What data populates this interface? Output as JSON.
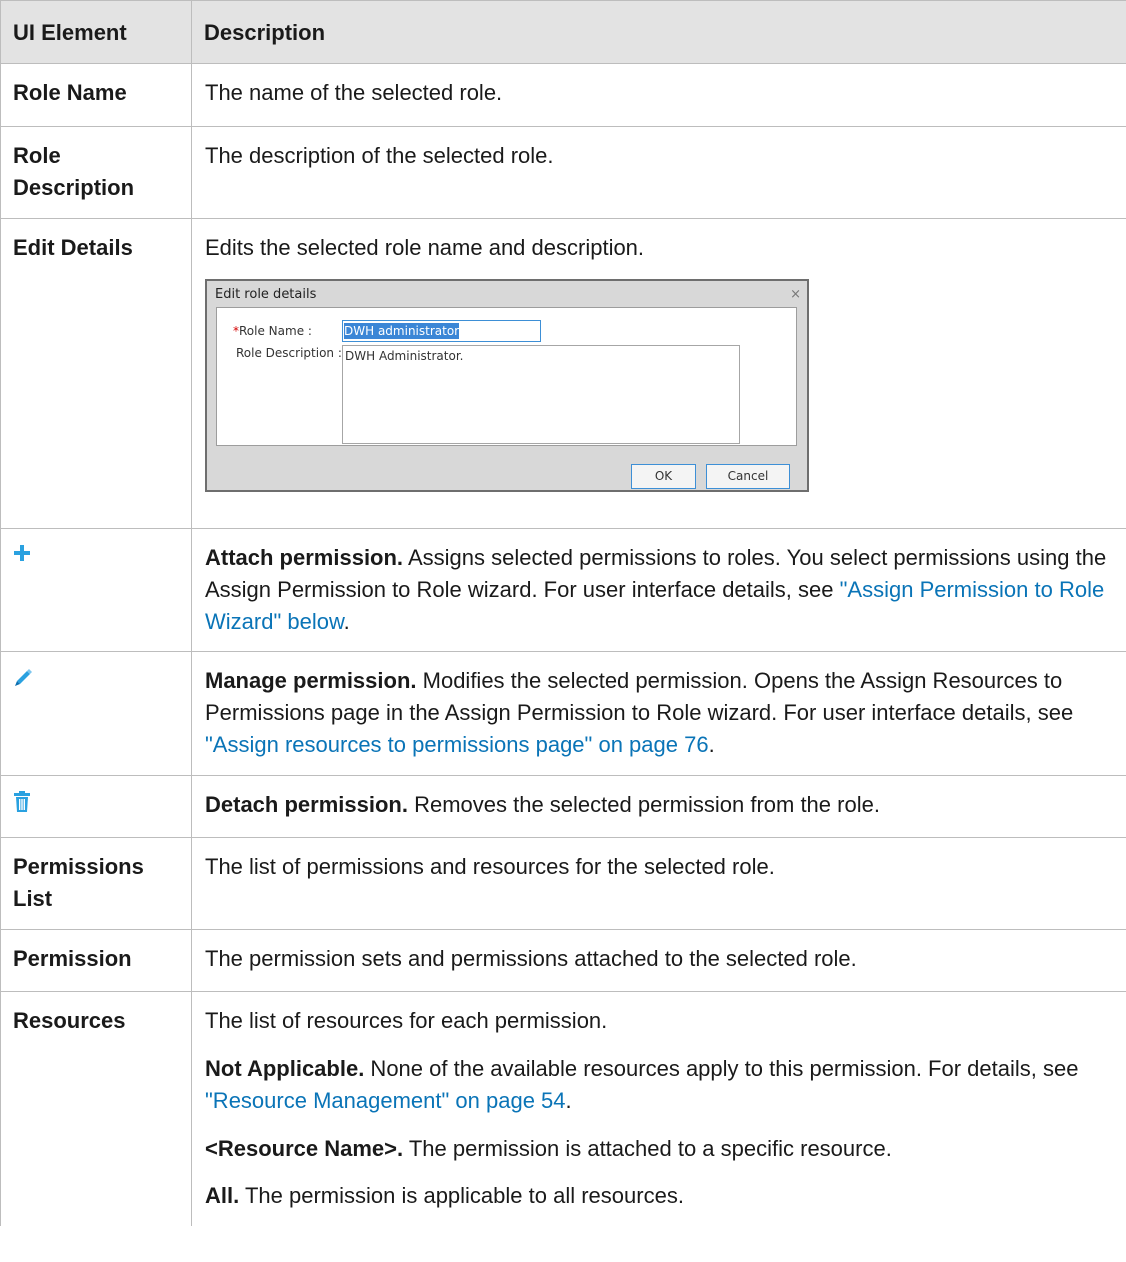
{
  "header": {
    "col1": "UI Element",
    "col2": "Description"
  },
  "rows": {
    "role_name": {
      "name": "Role Name",
      "desc": "The name of the selected role."
    },
    "role_desc": {
      "name": "Role Description",
      "desc": "The description of the selected role."
    },
    "edit_details": {
      "name": "Edit Details",
      "desc": "Edits the selected role name and description.",
      "dialog": {
        "title": "Edit role details",
        "close": "×",
        "required_mark": "*",
        "role_name_label": "Role Name :",
        "role_name_value": "DWH administrator",
        "role_desc_label": "Role Description :",
        "role_desc_value": "DWH Administrator.",
        "ok": "OK",
        "cancel": "Cancel"
      }
    },
    "attach": {
      "icon": "plus-icon",
      "bold": "Attach permission.",
      "text": " Assigns selected permissions to roles. You select permissions using the Assign Permission to Role wizard. For user interface details, see ",
      "link": "\"Assign Permission to Role Wizard\" below",
      "end": "."
    },
    "manage": {
      "icon": "pencil-icon",
      "bold": "Manage permission.",
      "text": " Modifies the selected permission. Opens the Assign Resources to Permissions page in the Assign Permission to Role wizard. For user interface details, see ",
      "link": "\"Assign resources to permissions page\" on page 76",
      "end": "."
    },
    "detach": {
      "icon": "trash-icon",
      "bold": "Detach permission.",
      "text": " Removes the selected permission from the role."
    },
    "perm_list": {
      "name": "Permissions List",
      "desc": "The list of permissions and resources for the selected role."
    },
    "permission": {
      "name": "Permission",
      "desc": "The permission sets and permissions attached to the selected role."
    },
    "resources": {
      "name": "Resources",
      "p1": "The list of resources for each permission.",
      "p2_bold": "Not Applicable.",
      "p2_text": " None of the available resources apply to this permission. For details, see ",
      "p2_link": "\"Resource Management\" on page 54",
      "p2_end": ".",
      "p3_bold": "<Resource Name>.",
      "p3_text": " The permission is attached to a specific resource.",
      "p4_bold": "All.",
      "p4_text": " The permission is applicable to all resources."
    }
  },
  "colors": {
    "link": "#0a74b7",
    "icon_blue": "#2aa1e0",
    "header_bg": "#e3e3e3"
  }
}
